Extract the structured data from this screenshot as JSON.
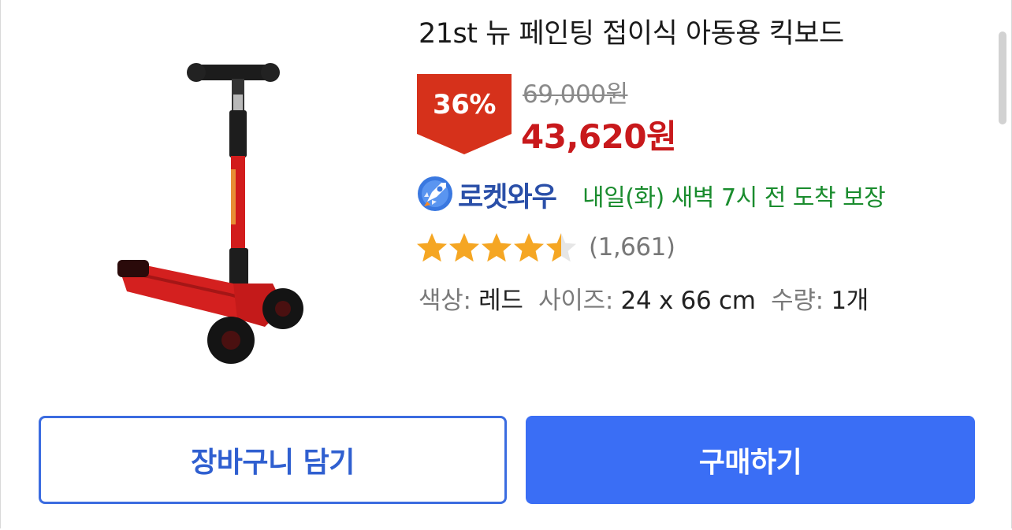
{
  "product": {
    "title": "21st 뉴 페인팅 접이식 아동용 킥보드",
    "image_alt": "red kids kick scooter"
  },
  "pricing": {
    "discount": "36%",
    "original_price": "69,000원",
    "sale_price": "43,620원"
  },
  "delivery": {
    "badge_label": "로켓와우",
    "text": "내일(화) 새벽 7시 전 도착 보장",
    "icon": "rocket-icon"
  },
  "rating": {
    "stars": 4.5,
    "max": 5,
    "review_count": "(1,661)"
  },
  "options": {
    "color_label": "색상:",
    "color_value": "레드",
    "size_label": "사이즈:",
    "size_value": "24 x 66 cm",
    "qty_label": "수량:",
    "qty_value": "1개"
  },
  "actions": {
    "add_to_cart": "장바구니 담기",
    "buy_now": "구매하기"
  },
  "colors": {
    "discount_badge": "#d6311b",
    "sale_price": "#c8191c",
    "delivery_green": "#1a8c2e",
    "rocket_blue": "#2a4fa8",
    "star": "#f5a623",
    "primary_button": "#3a6ef5"
  }
}
